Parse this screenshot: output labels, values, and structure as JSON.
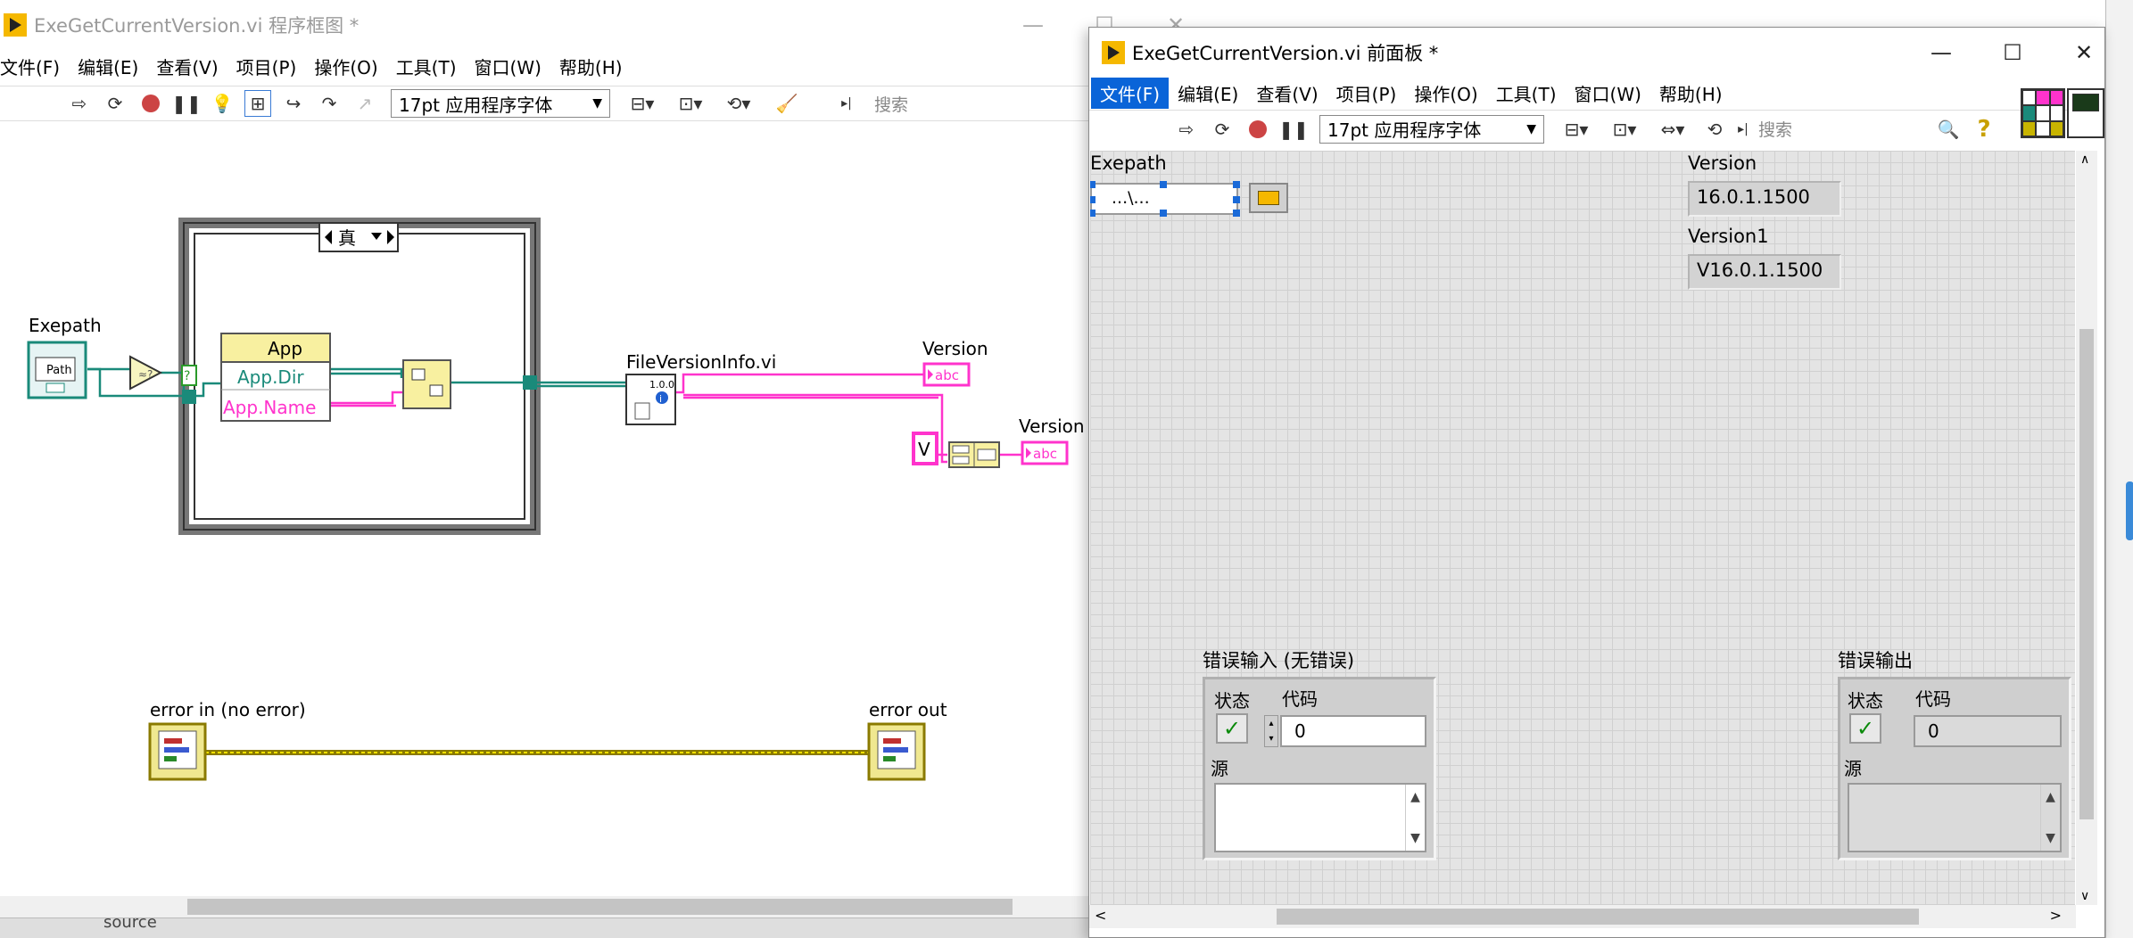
{
  "block_diagram": {
    "title": "ExeGetCurrentVersion.vi 程序框图 *",
    "menu": [
      "文件(F)",
      "编辑(E)",
      "查看(V)",
      "项目(P)",
      "操作(O)",
      "工具(T)",
      "窗口(W)",
      "帮助(H)"
    ],
    "font_select": "17pt 应用程序字体",
    "search_placeholder": "搜索",
    "case_selector": "真",
    "labels": {
      "exepath": "Exepath",
      "path_glyph": "Path",
      "app_node": "App",
      "app_dir": "App.Dir",
      "app_name": "App.Name",
      "file_version_vi": "FileVersionInfo.vi",
      "file_version_ver": "1.0.0",
      "version": "Version",
      "version_trunc": "Version",
      "v_const": "V",
      "abc": "abc",
      "error_in": "error in (no error)",
      "error_out": "error out",
      "source_trunc": "source"
    }
  },
  "front_panel": {
    "title": "ExeGetCurrentVersion.vi 前面板 *",
    "menu": [
      "文件(F)",
      "编辑(E)",
      "查看(V)",
      "项目(P)",
      "操作(O)",
      "工具(T)",
      "窗口(W)",
      "帮助(H)"
    ],
    "active_menu": "文件(F)",
    "font_select": "17pt 应用程序字体",
    "search_placeholder": "搜索",
    "controls": {
      "exepath_label": "Exepath",
      "exepath_value": "...\\...",
      "version_label": "Version",
      "version_value": "16.0.1.1500",
      "version1_label": "Version1",
      "version1_value": "V16.0.1.1500"
    },
    "error_in": {
      "label": "错误输入 (无错误)",
      "status": "状态",
      "code": "代码",
      "code_value": "0",
      "source": "源"
    },
    "error_out": {
      "label": "错误输出",
      "status": "状态",
      "code": "代码",
      "code_value": "0",
      "source": "源"
    }
  },
  "colors": {
    "string_wire": "#ff33cc",
    "path_wire": "#1a8a7a",
    "error_wire": "#c8b400",
    "lv_yellow": "#f5b800",
    "menu_active": "#0a64d8"
  }
}
